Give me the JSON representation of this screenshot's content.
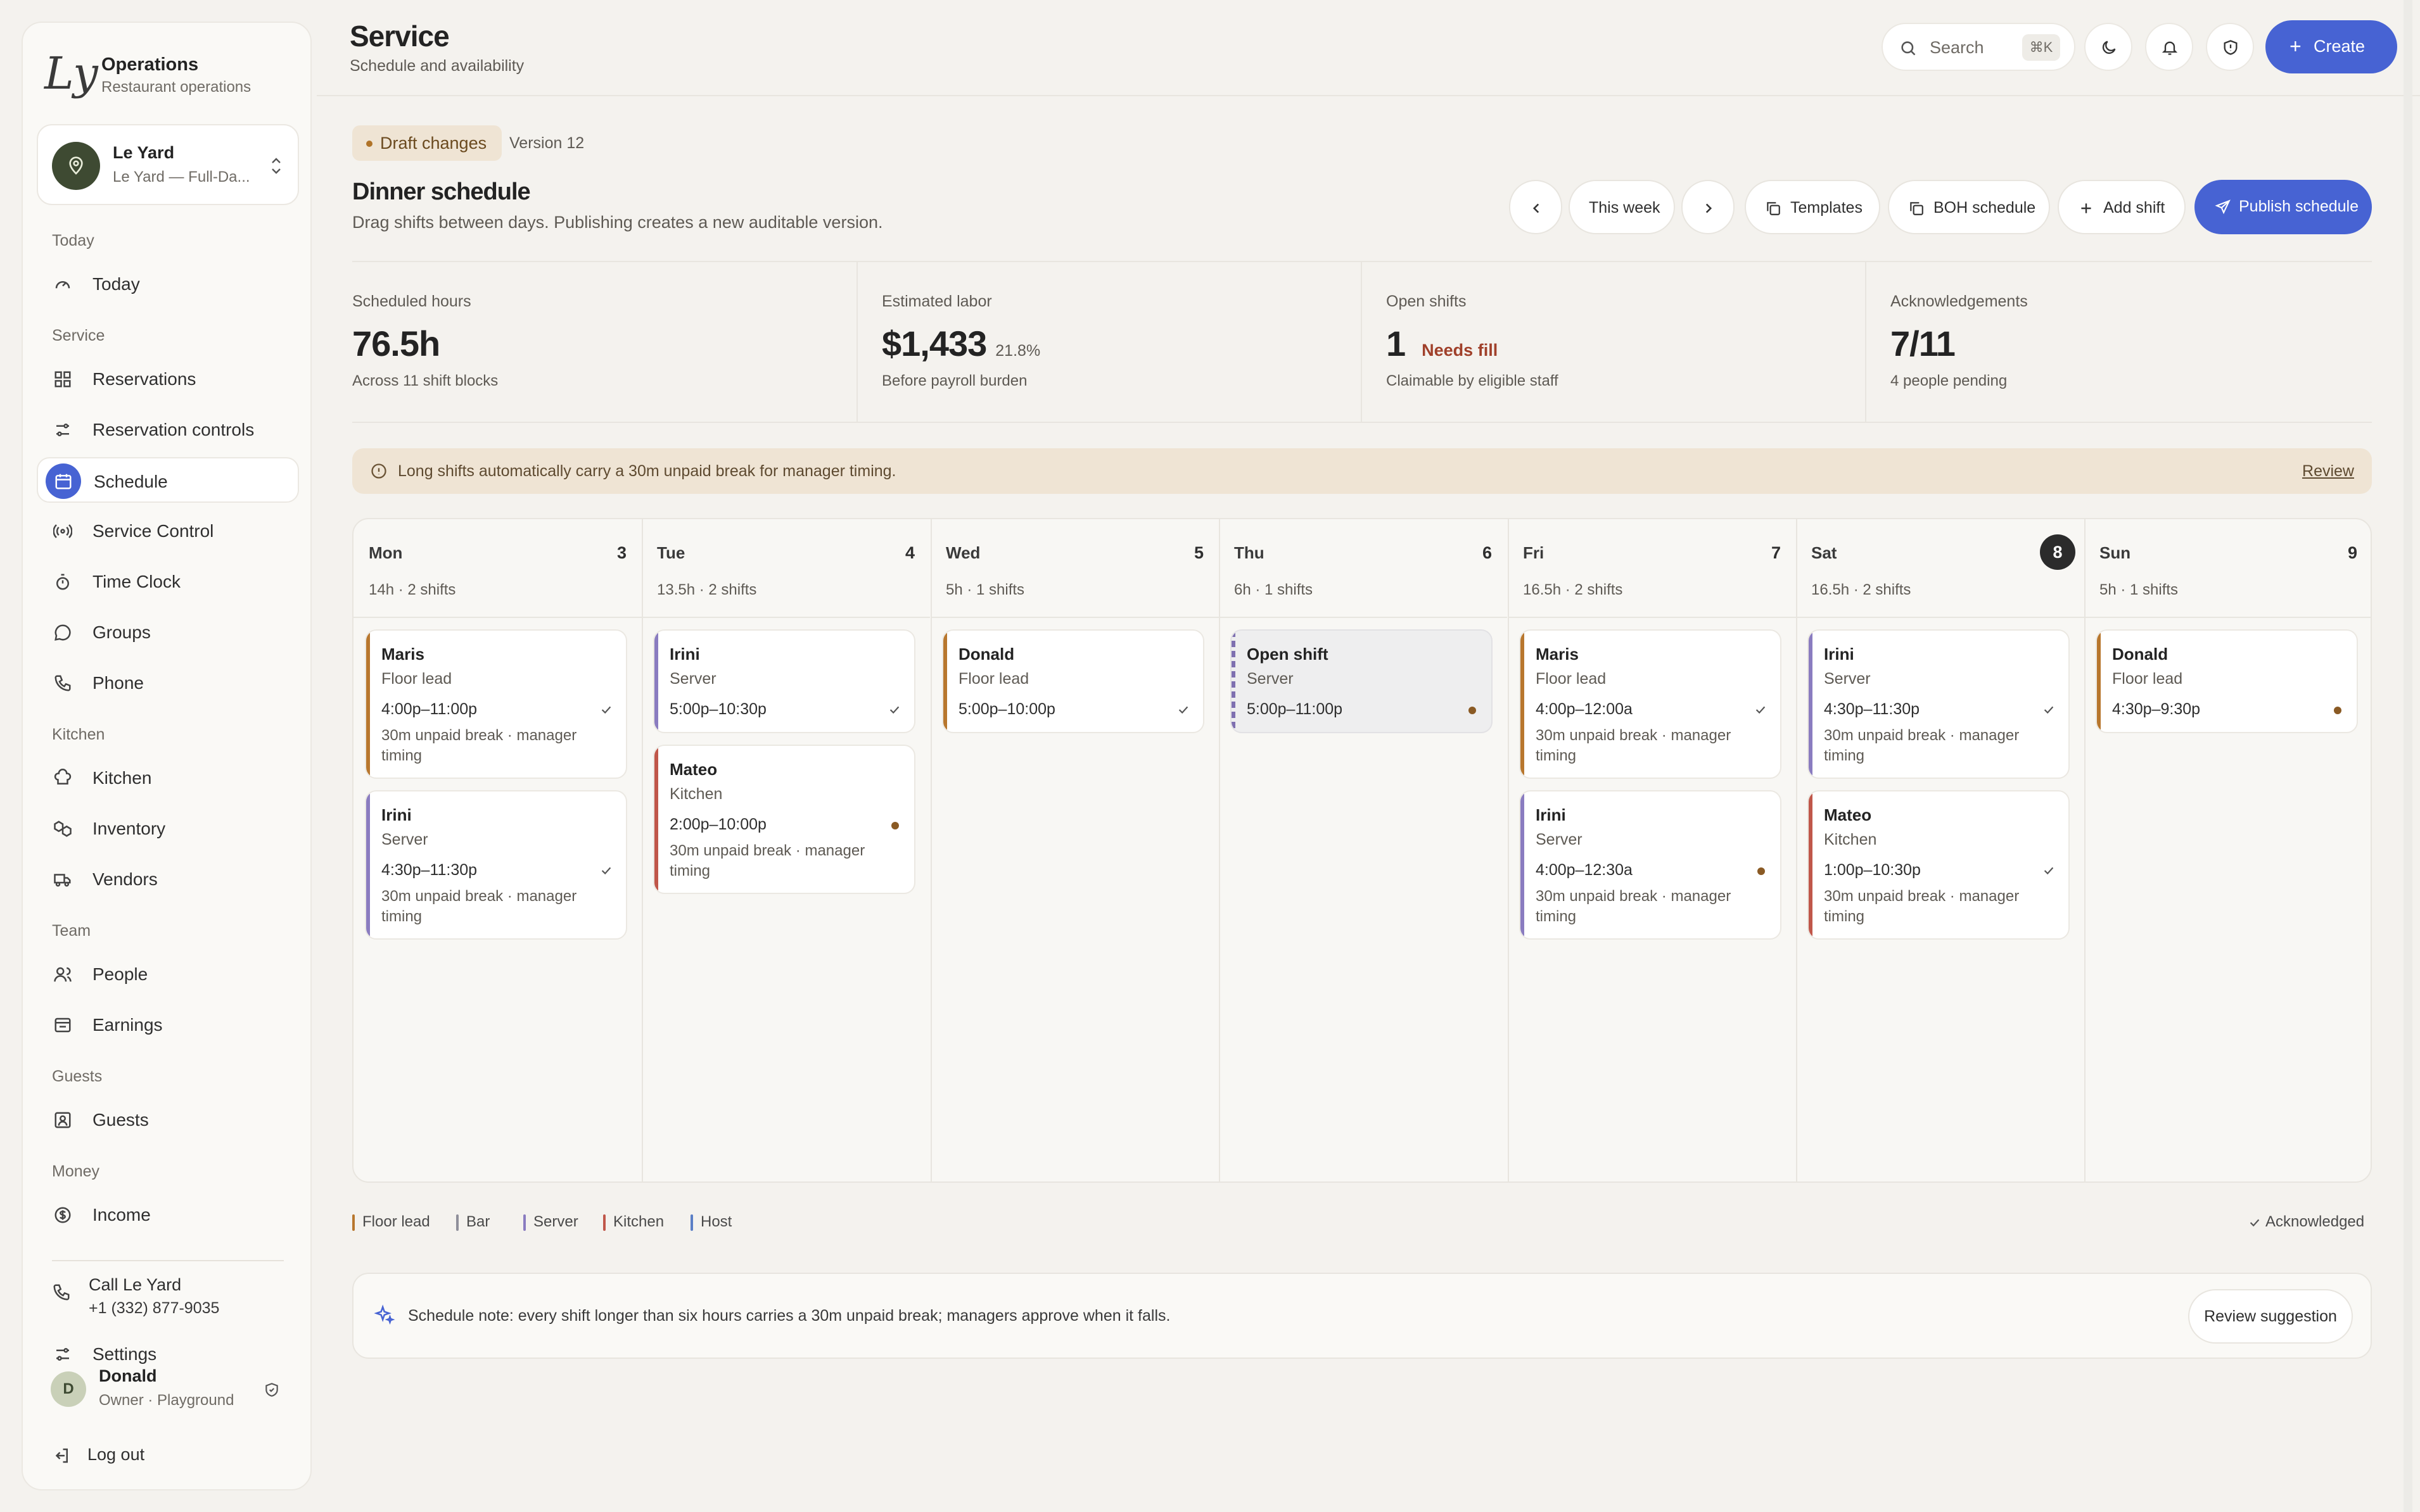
{
  "brand": {
    "logo": "Ly",
    "title": "Operations",
    "subtitle": "Restaurant operations"
  },
  "venue": {
    "name": "Le Yard",
    "full": "Le Yard — Full-Da..."
  },
  "sections": {
    "today": "Today",
    "service": "Service",
    "kitchen": "Kitchen",
    "team": "Team",
    "guests": "Guests",
    "money": "Money"
  },
  "nav": {
    "today": "Today",
    "reservations": "Reservations",
    "reservation_controls": "Reservation controls",
    "schedule": "Schedule",
    "service_control": "Service Control",
    "time_clock": "Time Clock",
    "groups": "Groups",
    "phone": "Phone",
    "kitchen": "Kitchen",
    "inventory": "Inventory",
    "vendors": "Vendors",
    "people": "People",
    "earnings": "Earnings",
    "guests": "Guests",
    "income": "Income",
    "settings": "Settings"
  },
  "call": {
    "label": "Call Le Yard",
    "number": "+1 (332) 877-9035"
  },
  "user": {
    "initial": "D",
    "name": "Donald",
    "role": "Owner · Playground"
  },
  "logout": "Log out",
  "header": {
    "title": "Service",
    "subtitle": "Schedule and availability",
    "search_placeholder": "Search",
    "search_shortcut": "⌘K",
    "create": "Create"
  },
  "draft": {
    "badge": "Draft changes",
    "version": "Version 12"
  },
  "schedule": {
    "title": "Dinner schedule",
    "subtitle": "Drag shifts between days. Publishing creates a new auditable version."
  },
  "toolbar": {
    "this_week": "This week",
    "templates": "Templates",
    "boh": "BOH schedule",
    "add_shift": "Add shift",
    "publish": "Publish schedule"
  },
  "stats": [
    {
      "label": "Scheduled hours",
      "value": "76.5h",
      "extra": "",
      "sub": "Across 11 shift blocks"
    },
    {
      "label": "Estimated labor",
      "value": "$1,433",
      "extra": "21.8%",
      "sub": "Before payroll burden"
    },
    {
      "label": "Open shifts",
      "value": "1",
      "extra": "Needs fill",
      "sub": "Claimable by eligible staff"
    },
    {
      "label": "Acknowledgements",
      "value": "7/11",
      "extra": "",
      "sub": "4 people pending"
    }
  ],
  "notice": {
    "text": "Long shifts automatically carry a 30m unpaid break for manager timing.",
    "action": "Review"
  },
  "days": [
    {
      "name": "Mon",
      "num": "3",
      "summary": "14h · 2 shifts",
      "today": false,
      "shifts": [
        {
          "name": "Maris",
          "role": "Floor lead",
          "time": "4:00p–11:00p",
          "note": "30m unpaid break · manager timing",
          "status": "ack"
        },
        {
          "name": "Irini",
          "role": "Server",
          "time": "4:30p–11:30p",
          "note": "30m unpaid break · manager timing",
          "status": "ack"
        }
      ]
    },
    {
      "name": "Tue",
      "num": "4",
      "summary": "13.5h · 2 shifts",
      "today": false,
      "shifts": [
        {
          "name": "Irini",
          "role": "Server",
          "time": "5:00p–10:30p",
          "note": "",
          "status": "ack"
        },
        {
          "name": "Mateo",
          "role": "Kitchen",
          "time": "2:00p–10:00p",
          "note": "30m unpaid break · manager timing",
          "status": "pending"
        }
      ]
    },
    {
      "name": "Wed",
      "num": "5",
      "summary": "5h · 1 shifts",
      "today": false,
      "shifts": [
        {
          "name": "Donald",
          "role": "Floor lead",
          "time": "5:00p–10:00p",
          "note": "",
          "status": "ack"
        }
      ]
    },
    {
      "name": "Thu",
      "num": "6",
      "summary": "6h · 1 shifts",
      "today": false,
      "shifts": [
        {
          "name": "Open shift",
          "role": "Server",
          "time": "5:00p–11:00p",
          "note": "",
          "status": "pending",
          "open": true
        }
      ]
    },
    {
      "name": "Fri",
      "num": "7",
      "summary": "16.5h · 2 shifts",
      "today": false,
      "shifts": [
        {
          "name": "Maris",
          "role": "Floor lead",
          "time": "4:00p–12:00a",
          "note": "30m unpaid break · manager timing",
          "status": "ack"
        },
        {
          "name": "Irini",
          "role": "Server",
          "time": "4:00p–12:30a",
          "note": "30m unpaid break · manager timing",
          "status": "pending"
        }
      ]
    },
    {
      "name": "Sat",
      "num": "8",
      "summary": "16.5h · 2 shifts",
      "today": true,
      "shifts": [
        {
          "name": "Irini",
          "role": "Server",
          "time": "4:30p–11:30p",
          "note": "30m unpaid break · manager timing",
          "status": "ack"
        },
        {
          "name": "Mateo",
          "role": "Kitchen",
          "time": "1:00p–10:30p",
          "note": "30m unpaid break · manager timing",
          "status": "ack"
        }
      ]
    },
    {
      "name": "Sun",
      "num": "9",
      "summary": "5h · 1 shifts",
      "today": false,
      "shifts": [
        {
          "name": "Donald",
          "role": "Floor lead",
          "time": "4:30p–9:30p",
          "note": "",
          "status": "pending"
        }
      ]
    }
  ],
  "role_colors": {
    "Floor lead": "#b8772e",
    "Bar": "#8f8f9a",
    "Server": "#8a7cc0",
    "Kitchen": "#c0574a",
    "Host": "#5b7fc6"
  },
  "legend": [
    {
      "label": "Floor lead",
      "color": "#b8772e"
    },
    {
      "label": "Bar",
      "color": "#8f8f9a"
    },
    {
      "label": "Server",
      "color": "#8a7cc0"
    },
    {
      "label": "Kitchen",
      "color": "#c0574a"
    },
    {
      "label": "Host",
      "color": "#5b7fc6"
    }
  ],
  "acknowledged": "Acknowledged",
  "footer_note": {
    "text": "Schedule note: every shift longer than six hours carries a 30m unpaid break; managers approve when it falls.",
    "action": "Review suggestion"
  },
  "colors": {
    "accent": "#4763d3",
    "draft_bg": "#efe4d4",
    "needs_fill": "#a0402a"
  }
}
